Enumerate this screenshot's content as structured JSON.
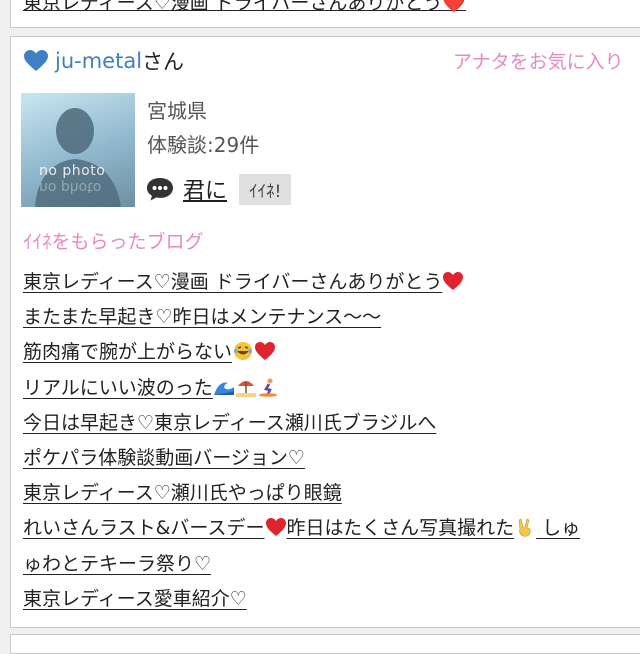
{
  "previous_card": {
    "blog_title": "東京レディース♡漫画 ドライバーさんありがとう❤️"
  },
  "user": {
    "name": "ju-metal",
    "suffix": "さん",
    "favorite_link": "アナタをお気に入り",
    "prefecture": "宮城県",
    "experience_label": "体験談:",
    "experience_count": "29件",
    "kimini_link": "君に",
    "iine_button": "ｲｲﾈ!",
    "avatar_text": "no photo",
    "heart_color": "#3f7fc4"
  },
  "section": {
    "title": "ｲｲﾈをもらったブログ"
  },
  "blogs": [
    "東京レディース♡漫画 ドライバーさんありがとう",
    "またまた早起き♡昨日はメンテナンス〜〜",
    "筋肉痛で腕が上がらない",
    "リアルにいい波のった",
    "今日は早起き♡東京レディース瀬川氏ブラジルへ",
    "ポケパラ体験談動画バージョン♡",
    "東京レディース♡瀬川氏やっぱり眼鏡",
    "れいさんラスト&バースデー",
    "ゅわとテキーラ祭り♡",
    "東京レディース愛車紹介♡"
  ],
  "blog8_tail": "昨日はたくさん写真撮れた",
  "blog8_end": " しゅ"
}
